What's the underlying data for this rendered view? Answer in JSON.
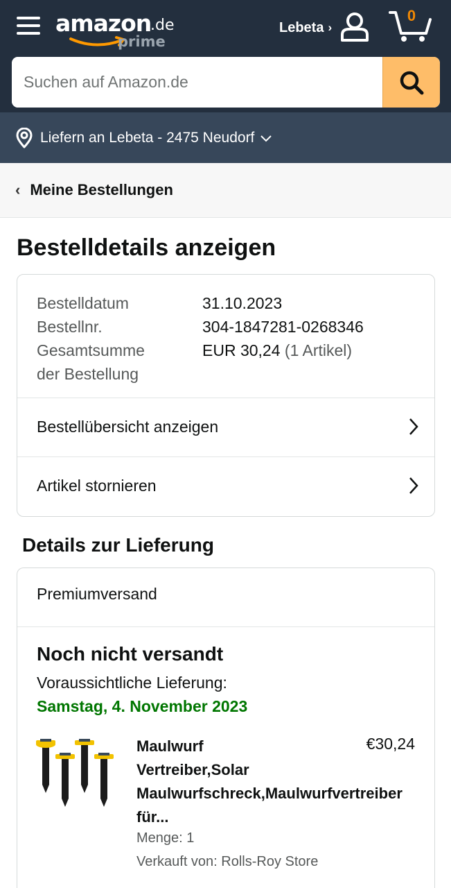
{
  "header": {
    "logo_word": "amazon",
    "logo_tld": ".de",
    "logo_sub": "prime",
    "account_label": "Lebeta",
    "account_chevron": "›",
    "cart_count": "0",
    "icons": [
      "menu-icon",
      "user-icon",
      "cart-icon",
      "search-icon",
      "location-pin-icon",
      "chevron-down-icon"
    ],
    "colors": {
      "header_bg": "#232f3e",
      "deliver_bg": "#37475a",
      "search_button": "#febd69",
      "cart_count": "#f08804"
    }
  },
  "search": {
    "placeholder": "Suchen auf Amazon.de"
  },
  "deliver": {
    "label": "Liefern an Lebeta - 2475 Neudorf"
  },
  "nav": {
    "back_label": "Meine Bestellungen"
  },
  "page": {
    "title": "Bestelldetails anzeigen"
  },
  "order": {
    "date_label": "Bestelldatum",
    "date_value": "31.10.2023",
    "number_label": "Bestellnr.",
    "number_value": "304-1847281-0268346",
    "total_label_line1": "Gesamtsumme",
    "total_label_line2": "der Bestellung",
    "total_value": "EUR 30,24",
    "total_items": "(1 Artikel)",
    "links": [
      "Bestellübersicht anzeigen",
      "Artikel stornieren"
    ]
  },
  "delivery": {
    "heading": "Details zur Lieferung",
    "shipping_method": "Premiumversand",
    "status": "Noch nicht versandt",
    "eta_label": "Voraussichtliche Lieferung:",
    "eta_date": "Samstag, 4. November 2023",
    "eta_color": "#007600",
    "item": {
      "title_lines": [
        "Maulwurf",
        "Vertreiber,Solar",
        "Maulwurfschreck,Maulwurfvertreiber",
        "für..."
      ],
      "price": "€30,24",
      "quantity": "Menge: 1",
      "seller": "Verkauft von: Rolls-Roy Store"
    }
  }
}
